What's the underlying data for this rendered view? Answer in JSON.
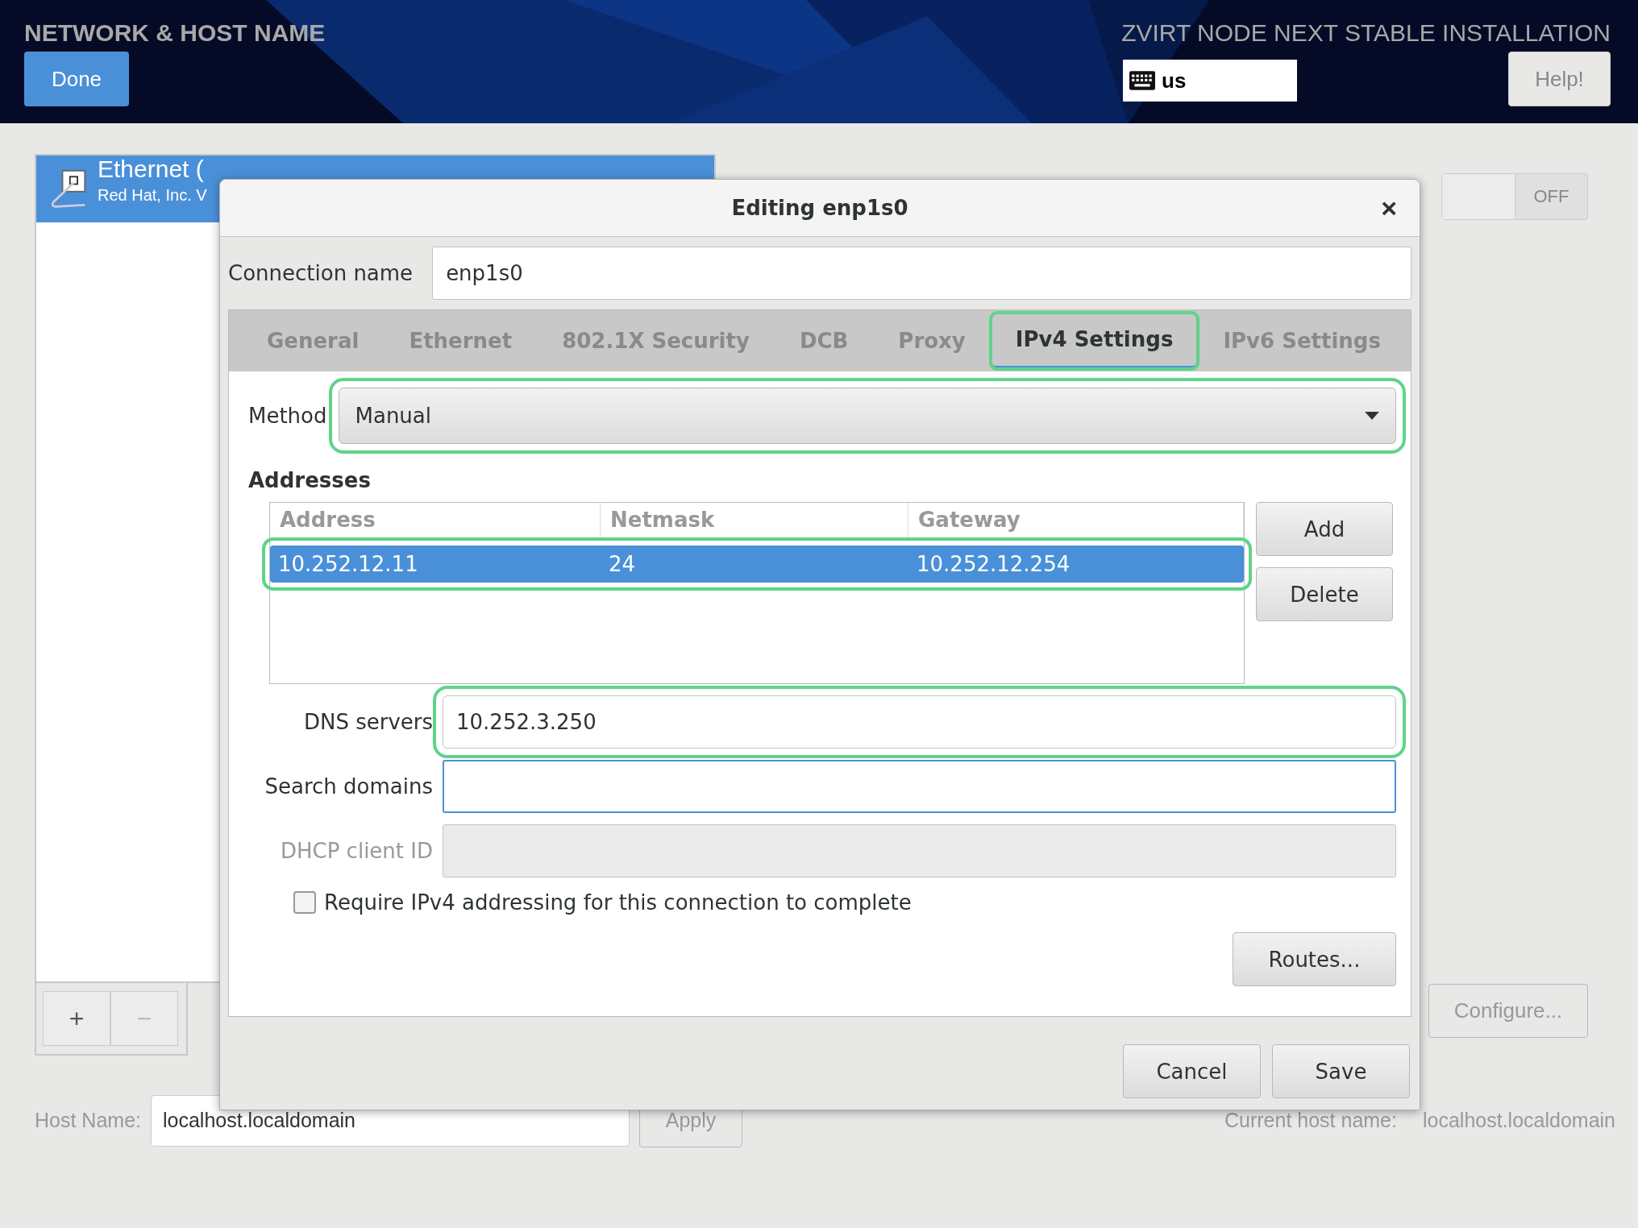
{
  "header": {
    "title": "NETWORK & HOST NAME",
    "done": "Done",
    "product": "ZVIRT NODE NEXT STABLE INSTALLATION",
    "keyboard_layout": "us",
    "help": "Help!"
  },
  "devices": [
    {
      "name": "Ethernet (",
      "vendor": "Red Hat, Inc. V",
      "selected": true
    }
  ],
  "device_buttons": [
    {
      "label": "+",
      "disabled": false
    },
    {
      "label": "−",
      "disabled": true
    }
  ],
  "toggle": {
    "label": "OFF",
    "on": false
  },
  "configure": "Configure...",
  "host_name": {
    "label": "Host Name:",
    "value": "localhost.localdomain",
    "apply": "Apply",
    "current_label": "Current host name:",
    "current_value": "localhost.localdomain"
  },
  "dialog": {
    "title": "Editing enp1s0",
    "close": "×",
    "connection_name": {
      "label": "Connection name",
      "value": "enp1s0"
    },
    "tabs": [
      {
        "label": "General",
        "selected": false,
        "highlighted": false
      },
      {
        "label": "Ethernet",
        "selected": false,
        "highlighted": false
      },
      {
        "label": "802.1X Security",
        "selected": false,
        "highlighted": false
      },
      {
        "label": "DCB",
        "selected": false,
        "highlighted": false
      },
      {
        "label": "Proxy",
        "selected": false,
        "highlighted": false
      },
      {
        "label": "IPv4 Settings",
        "selected": true,
        "highlighted": true
      },
      {
        "label": "IPv6 Settings",
        "selected": false,
        "highlighted": false
      }
    ],
    "method": {
      "label": "Method",
      "value": "Manual",
      "highlighted": true
    },
    "addresses": {
      "heading": "Addresses",
      "columns": [
        "Address",
        "Netmask",
        "Gateway"
      ],
      "rows": [
        {
          "address": "10.252.12.11",
          "netmask": "24",
          "gateway": "10.252.12.254",
          "selected": true,
          "highlighted": true
        }
      ],
      "add": "Add",
      "delete": "Delete"
    },
    "dns": {
      "label": "DNS servers",
      "value": "10.252.3.250",
      "highlighted": true
    },
    "search_domains": {
      "label": "Search domains",
      "focused": true
    },
    "dhcp_client_id": {
      "label": "DHCP client ID",
      "disabled": true
    },
    "require": {
      "label": "Require IPv4 addressing for this connection to complete",
      "checked": false
    },
    "routes": "Routes...",
    "cancel": "Cancel",
    "save": "Save"
  }
}
